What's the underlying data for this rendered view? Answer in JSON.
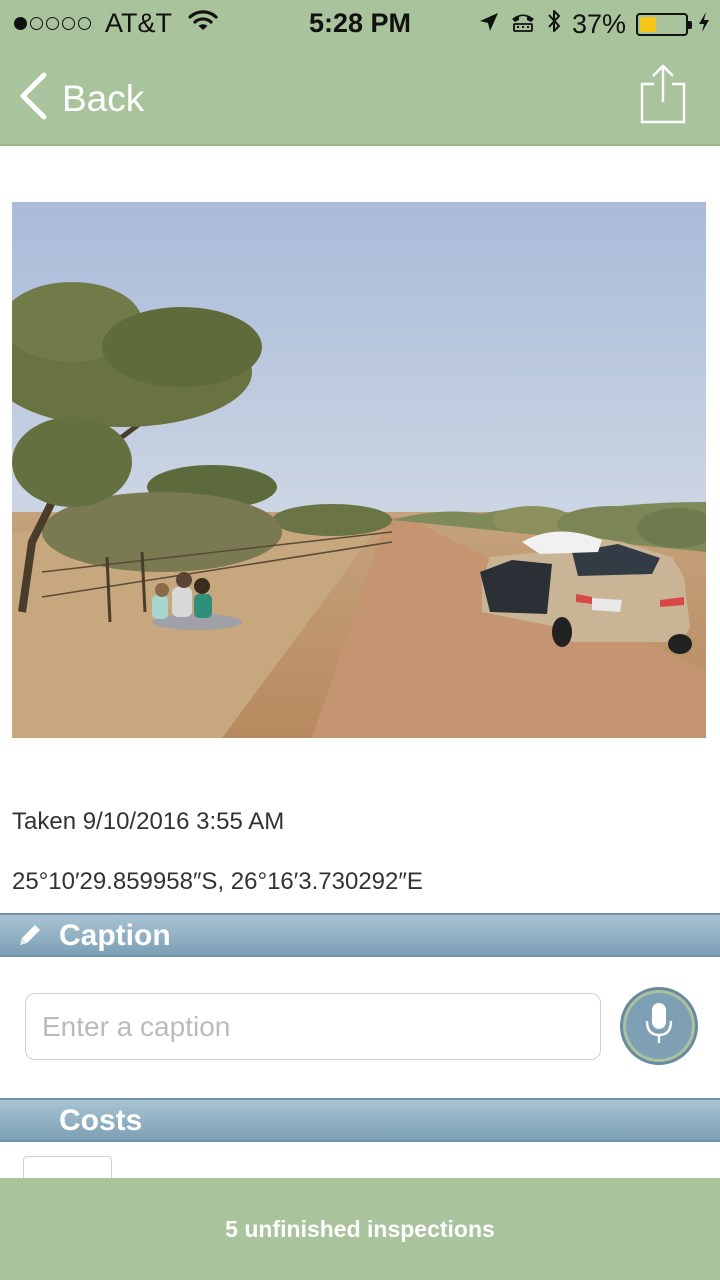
{
  "status_bar": {
    "carrier": "AT&T",
    "time": "5:28 PM",
    "battery": "37%",
    "battery_level": 0.37,
    "signal_bars_filled": 1,
    "signal_bars_total": 5,
    "icons": [
      "wifi-icon",
      "location-arrow-icon",
      "tty-icon",
      "bluetooth-icon",
      "battery-icon",
      "charging-icon"
    ]
  },
  "nav": {
    "back_label": "Back",
    "share_icon": "share-icon"
  },
  "photo": {
    "description_icon": "photo"
  },
  "meta": {
    "taken": "Taken 9/10/2016 3:55 AM",
    "coordinates": "25°10′29.859958″S, 26°16′3.730292″E"
  },
  "caption_section": {
    "title": "Caption",
    "placeholder": "Enter a caption",
    "value": ""
  },
  "costs_section": {
    "title": "Costs"
  },
  "footer": {
    "label": "5 unfinished inspections"
  },
  "colors": {
    "nav_green": "#a9c49d",
    "section_blue": "#7c9fb5",
    "battery_yellow": "#f5c518"
  }
}
